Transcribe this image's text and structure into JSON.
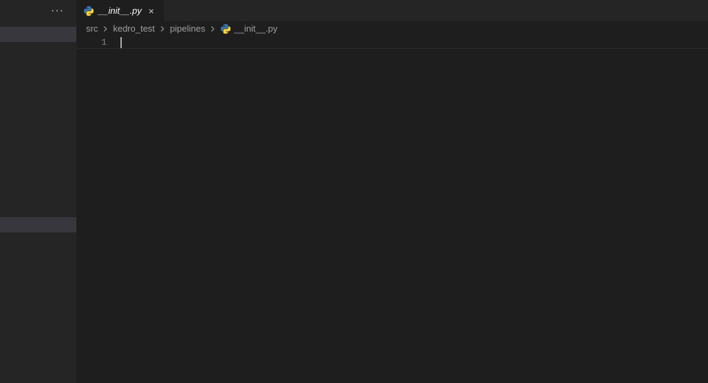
{
  "sidebar": {
    "more_label": "···"
  },
  "tab": {
    "icon": "python-icon",
    "label": "__init__.py",
    "close": "×"
  },
  "breadcrumbs": [
    {
      "label": "src",
      "icon": null
    },
    {
      "label": "kedro_test",
      "icon": null
    },
    {
      "label": "pipelines",
      "icon": null
    },
    {
      "label": "__init__.py",
      "icon": "python-icon"
    }
  ],
  "editor": {
    "line_numbers": [
      "1"
    ],
    "content": [
      ""
    ]
  }
}
